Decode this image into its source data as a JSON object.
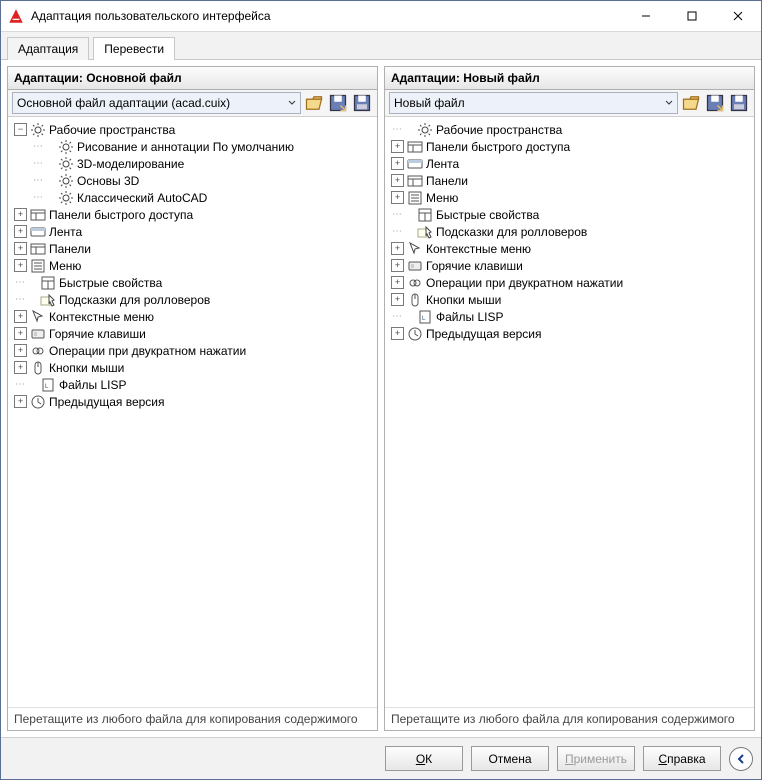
{
  "window": {
    "title": "Адаптация пользовательского интерфейса"
  },
  "tabs": {
    "adapt": "Адаптация",
    "translate": "Перевести"
  },
  "left": {
    "header": "Адаптации: Основной файл",
    "combo": "Основной файл адаптации (acad.cuix)",
    "hint": "Перетащите из любого файла для копирования содержимого",
    "tree": [
      {
        "d": 0,
        "exp": "-",
        "icon": "gear",
        "label": "Рабочие пространства"
      },
      {
        "d": 1,
        "exp": ".",
        "icon": "gear",
        "label": "Рисование и аннотации По умолчанию"
      },
      {
        "d": 1,
        "exp": ".",
        "icon": "gear",
        "label": "3D-моделирование"
      },
      {
        "d": 1,
        "exp": ".",
        "icon": "gear",
        "label": "Основы 3D"
      },
      {
        "d": 1,
        "exp": ".",
        "icon": "gear",
        "label": "Классический AutoCAD"
      },
      {
        "d": 0,
        "exp": "+",
        "icon": "panels",
        "label": "Панели быстрого доступа"
      },
      {
        "d": 0,
        "exp": "+",
        "icon": "ribbon",
        "label": "Лента"
      },
      {
        "d": 0,
        "exp": "+",
        "icon": "panels",
        "label": "Панели"
      },
      {
        "d": 0,
        "exp": "+",
        "icon": "menu",
        "label": "Меню"
      },
      {
        "d": 0,
        "exp": ".",
        "icon": "props",
        "label": "Быстрые свойства"
      },
      {
        "d": 0,
        "exp": ".",
        "icon": "rollover",
        "label": "Подсказки для ролловеров"
      },
      {
        "d": 0,
        "exp": "+",
        "icon": "cursor",
        "label": "Контекстные меню"
      },
      {
        "d": 0,
        "exp": "+",
        "icon": "hotkey",
        "label": "Горячие клавиши"
      },
      {
        "d": 0,
        "exp": "+",
        "icon": "dblclick",
        "label": "Операции при двукратном нажатии"
      },
      {
        "d": 0,
        "exp": "+",
        "icon": "mouse",
        "label": "Кнопки мыши"
      },
      {
        "d": 0,
        "exp": ".",
        "icon": "lisp",
        "label": "Файлы LISP"
      },
      {
        "d": 0,
        "exp": "+",
        "icon": "clock",
        "label": "Предыдущая версия"
      }
    ]
  },
  "right": {
    "header": "Адаптации: Новый файл",
    "combo": "Новый файл",
    "hint": "Перетащите из любого файла для копирования содержимого",
    "tree": [
      {
        "d": 0,
        "exp": ".",
        "icon": "gear",
        "label": "Рабочие пространства"
      },
      {
        "d": 0,
        "exp": "+",
        "icon": "panels",
        "label": "Панели быстрого доступа"
      },
      {
        "d": 0,
        "exp": "+",
        "icon": "ribbon",
        "label": "Лента"
      },
      {
        "d": 0,
        "exp": "+",
        "icon": "panels",
        "label": "Панели"
      },
      {
        "d": 0,
        "exp": "+",
        "icon": "menu",
        "label": "Меню"
      },
      {
        "d": 0,
        "exp": ".",
        "icon": "props",
        "label": "Быстрые свойства"
      },
      {
        "d": 0,
        "exp": ".",
        "icon": "rollover",
        "label": "Подсказки для ролловеров"
      },
      {
        "d": 0,
        "exp": "+",
        "icon": "cursor",
        "label": "Контекстные меню"
      },
      {
        "d": 0,
        "exp": "+",
        "icon": "hotkey",
        "label": "Горячие клавиши"
      },
      {
        "d": 0,
        "exp": "+",
        "icon": "dblclick",
        "label": "Операции при двукратном нажатии"
      },
      {
        "d": 0,
        "exp": "+",
        "icon": "mouse",
        "label": "Кнопки мыши"
      },
      {
        "d": 0,
        "exp": ".",
        "icon": "lisp",
        "label": "Файлы LISP"
      },
      {
        "d": 0,
        "exp": "+",
        "icon": "clock",
        "label": "Предыдущая версия"
      }
    ]
  },
  "footer": {
    "ok": "ОК",
    "cancel": "Отмена",
    "apply": "Применить",
    "help": "Справка"
  },
  "icons": {
    "gear": "<svg viewBox='0 0 16 16'><circle cx='8' cy='8' r='3' fill='none' stroke='#444'/><path d='M8 1v2M8 13v2M1 8h2M13 8h2M3 3l1.4 1.4M11.6 11.6L13 13M13 3l-1.4 1.4M4.4 11.6L3 13' stroke='#444'/></svg>",
    "panels": "<svg viewBox='0 0 16 16'><rect x='1' y='3' width='14' height='10' fill='none' stroke='#555'/><line x1='1' y1='6' x2='15' y2='6' stroke='#555'/><line x1='6' y1='6' x2='6' y2='13' stroke='#555'/></svg>",
    "ribbon": "<svg viewBox='0 0 16 16'><rect x='1' y='4' width='14' height='8' rx='1' fill='none' stroke='#555'/><rect x='1' y='4' width='14' height='3' fill='#bcd'/></svg>",
    "menu": "<svg viewBox='0 0 16 16'><rect x='2' y='2' width='12' height='12' fill='none' stroke='#555'/><line x1='4' y1='5' x2='12' y2='5' stroke='#555'/><line x1='4' y1='8' x2='12' y2='8' stroke='#555'/><line x1='4' y1='11' x2='12' y2='11' stroke='#555'/></svg>",
    "props": "<svg viewBox='0 0 16 16'><rect x='2' y='2' width='12' height='12' fill='none' stroke='#555'/><line x1='2' y1='6' x2='14' y2='6' stroke='#555'/><line x1='8' y1='6' x2='8' y2='14' stroke='#555'/></svg>",
    "rollover": "<svg viewBox='0 0 16 16'><rect x='1' y='5' width='10' height='8' fill='#ffe' stroke='#aa8'/><path d='M9 3l5 5-2 1 2 4-2 1-2-4-1 2z' fill='#fff' stroke='#444'/></svg>",
    "cursor": "<svg viewBox='0 0 16 16'><path d='M3 2l4 10 1-4 4-1z' fill='#fff' stroke='#444'/></svg>",
    "hotkey": "<svg viewBox='0 0 16 16'><rect x='2' y='4' width='12' height='8' rx='1' fill='#eee' stroke='#555'/><rect x='4' y='6' width='3' height='4' fill='#ccc'/></svg>",
    "dblclick": "<svg viewBox='0 0 16 16'><circle cx='6' cy='8' r='3' fill='none' stroke='#555'/><circle cx='10' cy='8' r='3' fill='none' stroke='#555'/></svg>",
    "mouse": "<svg viewBox='0 0 16 16'><rect x='5' y='2' width='6' height='12' rx='3' fill='none' stroke='#555'/><line x1='8' y1='2' x2='8' y2='7' stroke='#555'/></svg>",
    "lisp": "<svg viewBox='0 0 16 16'><rect x='3' y='2' width='10' height='12' fill='#fff' stroke='#555'/><text x='5' y='11' font-size='6' fill='#357'>L</text></svg>",
    "clock": "<svg viewBox='0 0 16 16'><circle cx='8' cy='8' r='6' fill='none' stroke='#555'/><path d='M8 4v4l3 2' stroke='#555' fill='none'/></svg>",
    "open": "<svg viewBox='0 0 16 16'><path d='M2 5h5l1-2h6v2H3z' fill='#e8c068' stroke='#a07020'/><path d='M2 5h12l-2 8H2z' fill='#f5d98a' stroke='#a07020'/></svg>",
    "saveas": "<svg viewBox='0 0 16 16'><rect x='2' y='2' width='12' height='12' fill='#6a7fb5' stroke='#334'/><rect x='5' y='2' width='6' height='5' fill='#fff'/><path d='M10 10l4 4M14 10v4h-4' stroke='#e8c068' fill='none'/></svg>",
    "save": "<svg viewBox='0 0 16 16'><rect x='2' y='2' width='12' height='12' fill='#6a7fb5' stroke='#334'/><rect x='5' y='2' width='6' height='5' fill='#fff'/><rect x='4' y='9' width='8' height='4' fill='#ccd'/></svg>"
  }
}
